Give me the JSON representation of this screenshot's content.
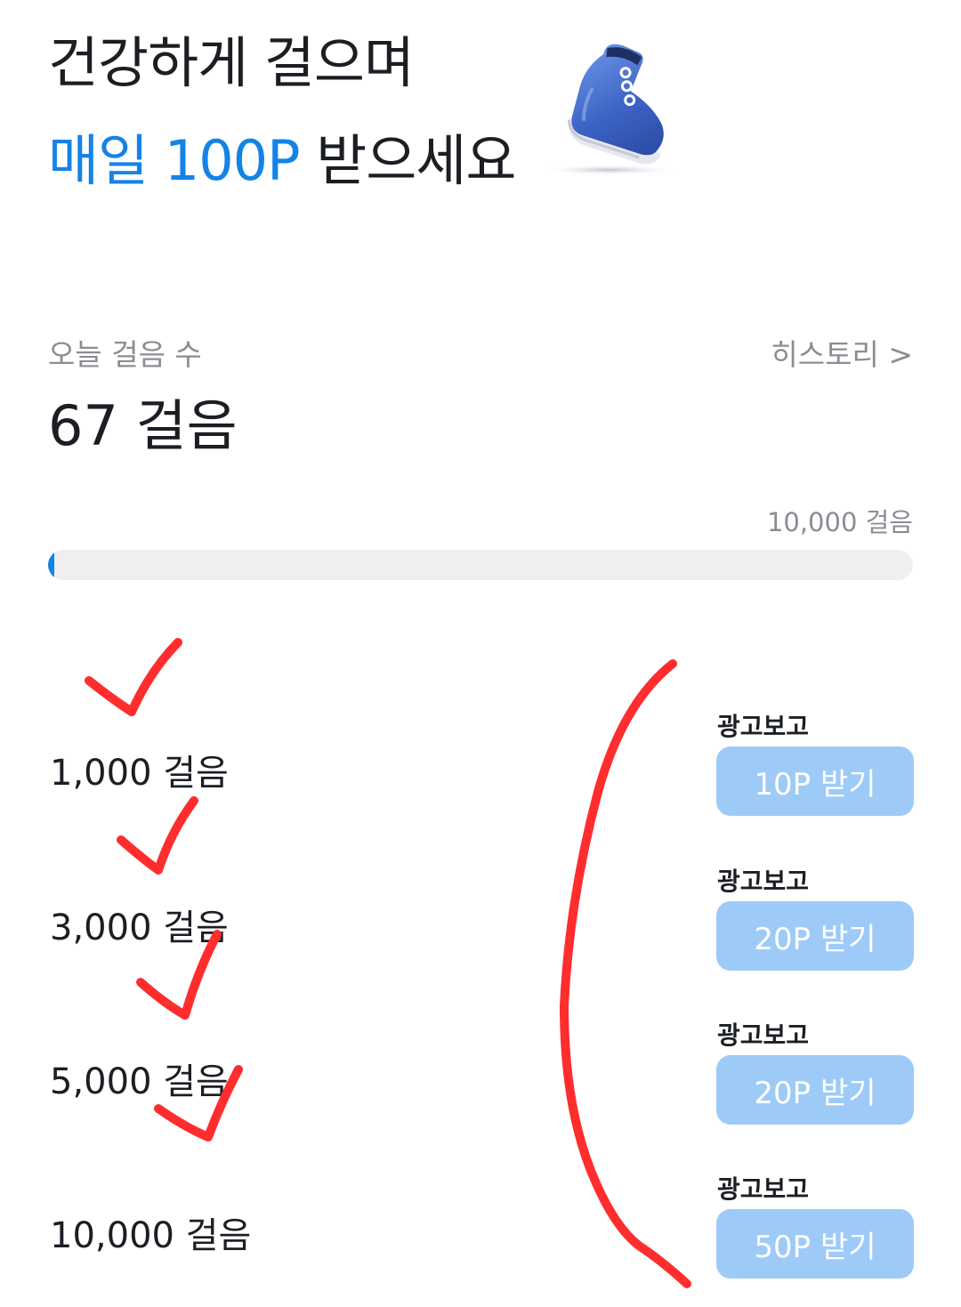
{
  "header": {
    "line1": "건강하게 걸으며",
    "line2_accent": "매일 100P",
    "line2_rest": " 받으세요",
    "accent_color": "#1483e6",
    "illustration": "blue-sneaker-icon"
  },
  "steps": {
    "label": "오늘 걸음 수",
    "history_link": "히스토리 >",
    "count": "67 걸음",
    "goal_label": "10,000 걸음",
    "progress": 0.0067
  },
  "milestones": [
    {
      "label": "1,000 걸음",
      "ad_caption": "광고보고",
      "button": "10P 받기"
    },
    {
      "label": "3,000 걸음",
      "ad_caption": "광고보고",
      "button": "20P 받기"
    },
    {
      "label": "5,000 걸음",
      "ad_caption": "광고보고",
      "button": "20P 받기"
    },
    {
      "label": "10,000 걸음",
      "ad_caption": "광고보고",
      "button": "50P 받기"
    }
  ],
  "colors": {
    "button_bg": "#9ecaf7",
    "track_bg": "#efeff1",
    "annotation": "#ff2d2d"
  },
  "annotations": {
    "checkmarks": 4,
    "bracket": "right-side"
  }
}
